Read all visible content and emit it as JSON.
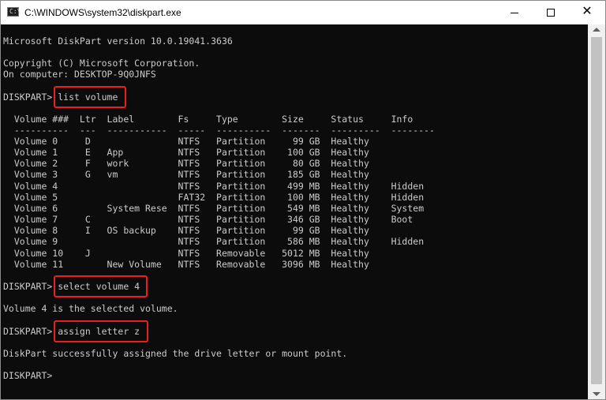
{
  "window": {
    "title": "C:\\WINDOWS\\system32\\diskpart.exe",
    "icon": "console-icon",
    "icon_text": "C:\\",
    "controls": {
      "minimize": "minimize-icon",
      "maximize": "maximize-icon",
      "close": "✕"
    }
  },
  "console": {
    "lines": [
      "Microsoft DiskPart version 10.0.19041.3636",
      "",
      "Copyright (C) Microsoft Corporation.",
      "On computer: DESKTOP-9Q0JNFS",
      "",
      "DISKPART> list volume",
      "",
      "  Volume ###  Ltr  Label        Fs     Type        Size     Status     Info",
      "  ----------  ---  -----------  -----  ----------  -------  ---------  --------",
      "  Volume 0     D                NTFS   Partition     99 GB  Healthy",
      "  Volume 1     E   App          NTFS   Partition    100 GB  Healthy",
      "  Volume 2     F   work         NTFS   Partition     80 GB  Healthy",
      "  Volume 3     G   vm           NTFS   Partition    185 GB  Healthy",
      "  Volume 4                      NTFS   Partition    499 MB  Healthy    Hidden",
      "  Volume 5                      FAT32  Partition    100 MB  Healthy    Hidden",
      "  Volume 6         System Rese  NTFS   Partition    549 MB  Healthy    System",
      "  Volume 7     C                NTFS   Partition    346 GB  Healthy    Boot",
      "  Volume 8     I   OS backup    NTFS   Partition     99 GB  Healthy",
      "  Volume 9                      NTFS   Partition    586 MB  Healthy    Hidden",
      "  Volume 10    J                NTFS   Removable   5012 MB  Healthy",
      "  Volume 11        New Volume   NTFS   Removable   3096 MB  Healthy",
      "",
      "DISKPART> select volume 4",
      "",
      "Volume 4 is the selected volume.",
      "",
      "DISKPART> assign letter z",
      "",
      "DiskPart successfully assigned the drive letter or mount point.",
      "",
      "DISKPART> "
    ]
  },
  "colors": {
    "console_bg": "#0c0c0c",
    "console_text": "#cccccc",
    "highlight": "#e8211b"
  }
}
